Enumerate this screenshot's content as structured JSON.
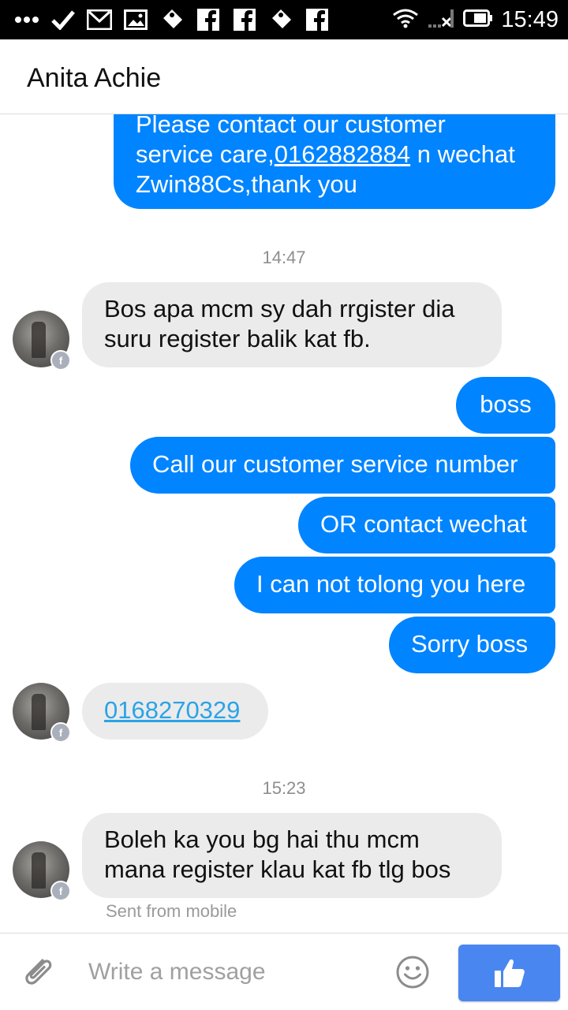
{
  "status_bar": {
    "time": "15:49",
    "icons": [
      "more-dots-icon",
      "check-icon",
      "gmail-icon",
      "image-icon",
      "tag-icon",
      "facebook-icon",
      "facebook-icon",
      "tag-icon",
      "facebook-icon",
      "wifi-icon",
      "signal-icon",
      "battery-icon"
    ]
  },
  "header": {
    "title": "Anita Achie"
  },
  "conversation": {
    "first_outgoing": {
      "line1": "Please contact our customer",
      "line2_prefix": "service care,",
      "line2_link": "0162882884",
      "line2_suffix": " n wechat",
      "line3": "Zwin88Cs,thank you"
    },
    "timestamp_1": "14:47",
    "incoming_1": {
      "line1": "Bos apa mcm sy dah rrgister dia",
      "line2": "suru register balik kat fb."
    },
    "outgoing_group": [
      "boss",
      "Call our customer service number",
      "OR contact wechat",
      "I can not tolong you here",
      "Sorry boss"
    ],
    "incoming_link": "0168270329",
    "timestamp_2": "15:23",
    "incoming_2": {
      "line1": "Boleh ka you bg hai thu mcm",
      "line2": "mana register klau kat fb tlg bos"
    },
    "sent_from": "Sent from mobile"
  },
  "composer": {
    "placeholder": "Write a message",
    "attach_icon": "paperclip-icon",
    "emoji_icon": "smiley-icon",
    "send_icon": "thumbs-up-icon"
  },
  "colors": {
    "outgoing_bubble": "#0084ff",
    "incoming_bubble": "#ebebeb",
    "link": "#2ba3e6",
    "like_button": "#4a86f0"
  }
}
